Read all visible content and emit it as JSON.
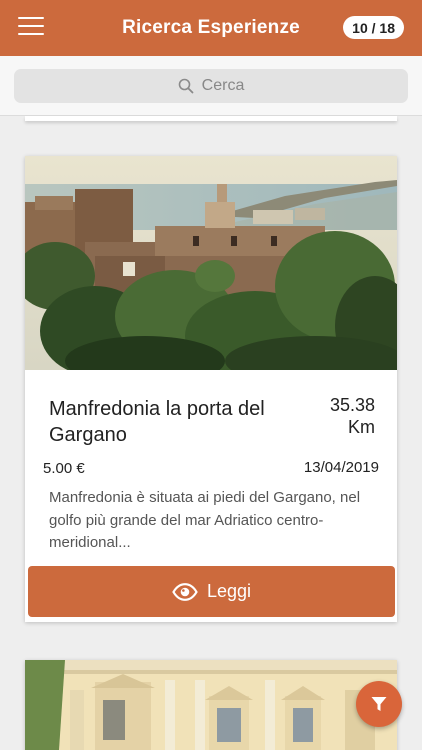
{
  "header": {
    "title": "Ricerca Esperienze",
    "counter": "10 / 18",
    "menu_icon": "hamburger-menu-icon"
  },
  "search": {
    "placeholder": "Cerca",
    "icon": "search-icon"
  },
  "experiences": [
    {
      "name": "Manfredonia la porta del Gargano",
      "distance_value": "35.38",
      "distance_unit": "Km",
      "price": "5.00 €",
      "date": "13/04/2019",
      "description": "Manfredonia è situata ai piedi del Gargano, nel golfo più grande del mar Adriatico centro-meridional...",
      "read_label": "Leggi",
      "read_icon": "eye-icon"
    }
  ],
  "filter_button": {
    "icon": "filter-icon"
  },
  "colors": {
    "accent": "#cc6a3d",
    "fab": "#d9653a",
    "background": "#eeeeee"
  }
}
